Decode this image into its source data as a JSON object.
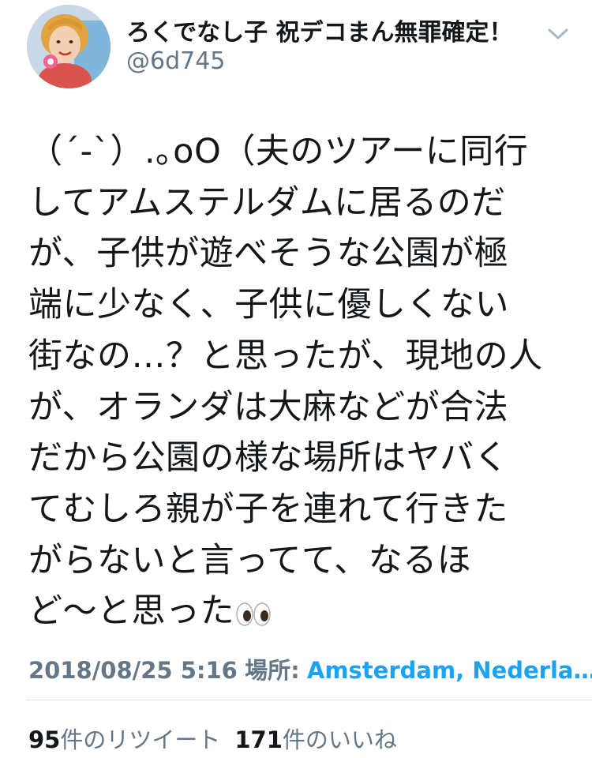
{
  "header": {
    "display_name": "ろくでなし子 祝デコまん無罪確定！",
    "handle": "@6d745",
    "avatar_icon": "user-avatar",
    "more_icon": "chevron-down-icon"
  },
  "tweet": {
    "text": "（´-`）.｡oO（夫のツアーに同行\nしてアムステルダムに居るのだ\nが、子供が遊べそうな公園が極\n端に少なく、子供に優しくない\n街なの…？と思ったが、現地の人\nが、オランダは大麻などが合法\nだから公園の様な場所はヤバく\nてむしろ親が子を連れて行きた\nがらないと言ってて、なるほ\nど〜と思った",
    "emoji_icon": "eyes-emoji-icon"
  },
  "meta": {
    "datetime": "2018/08/25 5:16",
    "place_label": "場所:",
    "place": "Amsterdam, Nederla…"
  },
  "stats": {
    "retweet_count": "95",
    "retweet_label": "件のリツイート",
    "like_count": "171",
    "like_label": "件のいいね"
  },
  "colors": {
    "text": "#14171a",
    "muted": "#657786",
    "link": "#1da1f2",
    "divider": "#e1e8ed"
  }
}
